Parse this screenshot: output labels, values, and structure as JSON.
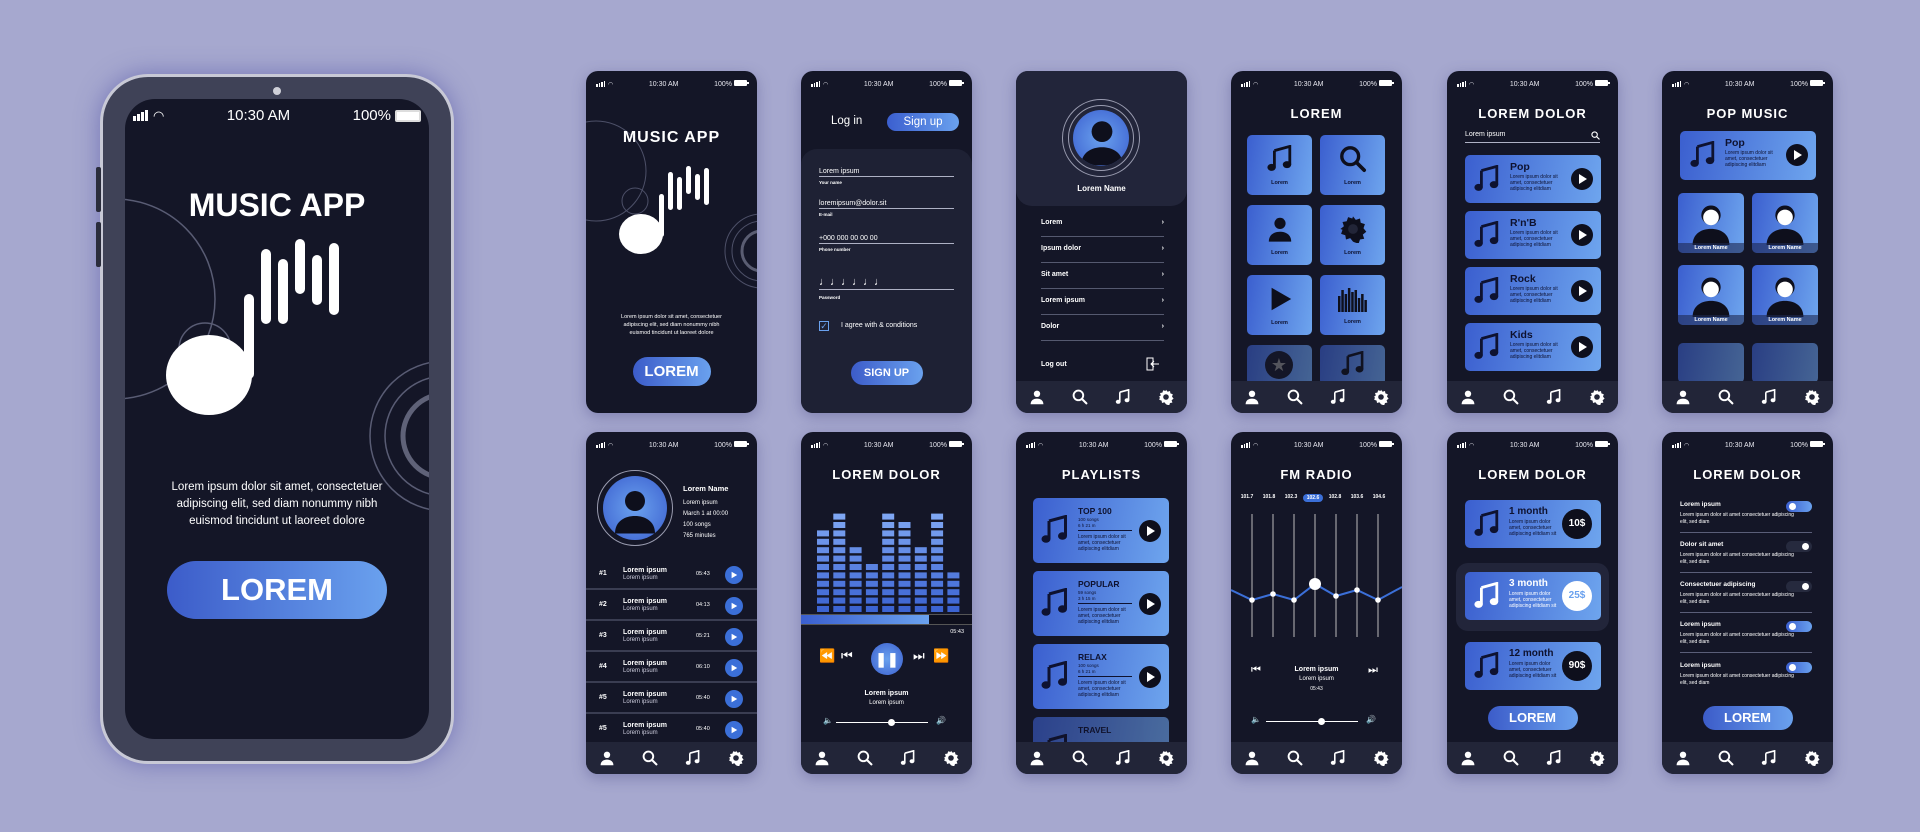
{
  "status_bar": {
    "time": "10:30 AM",
    "battery": "100%"
  },
  "nav": [
    "profile-icon",
    "search-icon",
    "music-note-icon",
    "gear-icon"
  ],
  "colors": {
    "background": "#a6a8cf",
    "screen": "#141627",
    "accent_start": "#3b5fcf",
    "accent_end": "#6ea5ee",
    "nav": "#222538"
  },
  "splash_large": {
    "title": "MUSIC APP",
    "description": "Lorem ipsum dolor sit amet, consectetuer adipiscing elit, sed diam nonummy nibh euismod tincidunt ut laoreet dolore",
    "button": "LOREM"
  },
  "splash": {
    "title": "MUSIC APP",
    "description": "Lorem ipsum dolor sit amet, consectetuer adipiscing elit, sed diam nonummy nibh euismod tincidunt ut laoreet dolore",
    "button": "LOREM"
  },
  "signup": {
    "tab_login": "Log in",
    "tab_signup": "Sign up",
    "fields": [
      {
        "value": "Lorem ipsum",
        "label": "Your name"
      },
      {
        "value": "loremipsum@dolor.sit",
        "label": "E-mail"
      },
      {
        "value": "+000 000 00 00 00",
        "label": "Phone number"
      },
      {
        "value": "♩♩♩♩♩♩",
        "label": "Password"
      }
    ],
    "agree": "I agree with & conditions",
    "button": "SIGN UP"
  },
  "profile": {
    "name": "Lorem Name",
    "menu": [
      "Lorem",
      "Ipsum dolor",
      "Sit amet",
      "Lorem ipsum",
      "Dolor"
    ],
    "logout": "Log out"
  },
  "grid": {
    "title": "LOREM",
    "tiles": [
      {
        "label": "Lorem",
        "icon": "music-note-icon"
      },
      {
        "label": "Lorem",
        "icon": "search-icon"
      },
      {
        "label": "Lorem",
        "icon": "person-icon"
      },
      {
        "label": "Lorem",
        "icon": "gear-icon"
      },
      {
        "label": "Lorem",
        "icon": "play-icon"
      },
      {
        "label": "Lorem",
        "icon": "equalizer-icon"
      }
    ]
  },
  "genres": {
    "title": "LOREM DOLOR",
    "search_value": "Lorem ipsum",
    "items": [
      {
        "name": "Pop",
        "desc": "Lorem ipsum dolor sit amet, consectetuer adipiscing elitdiam"
      },
      {
        "name": "R'n'B",
        "desc": "Lorem ipsum dolor sit amet, consectetuer adipiscing elitdiam"
      },
      {
        "name": "Rock",
        "desc": "Lorem ipsum dolor sit amet, consectetuer adipiscing elitdiam"
      },
      {
        "name": "Kids",
        "desc": "Lorem ipsum dolor sit amet, consectetuer adipiscing elitdiam"
      }
    ]
  },
  "pop_music": {
    "title": "POP MUSIC",
    "feature": {
      "name": "Pop",
      "desc": "Lorem ipsum dolor sit amet, consectetuer adipiscing elitdiam"
    },
    "artists": [
      "Lorem Name",
      "Lorem Name",
      "Lorem Name",
      "Lorem Name"
    ]
  },
  "artist": {
    "name": "Lorem Name",
    "info": [
      "Lorem ipsum",
      "March 1 at 00:00",
      "100 songs",
      "765 minutes"
    ],
    "tracks": [
      {
        "num": "#1",
        "title": "Lorem ipsum",
        "sub": "Lorem ipsum",
        "time": "05:43"
      },
      {
        "num": "#2",
        "title": "Lorem ipsum",
        "sub": "Lorem ipsum",
        "time": "04:13"
      },
      {
        "num": "#3",
        "title": "Lorem ipsum",
        "sub": "Lorem ipsum",
        "time": "05:21"
      },
      {
        "num": "#4",
        "title": "Lorem ipsum",
        "sub": "Lorem ipsum",
        "time": "06:10"
      },
      {
        "num": "#5",
        "title": "Lorem ipsum",
        "sub": "Lorem ipsum",
        "time": "05:40"
      },
      {
        "num": "#5",
        "title": "Lorem ipsum",
        "sub": "Lorem ipsum",
        "time": "05:40"
      }
    ]
  },
  "player": {
    "title": "LOREM DOLOR",
    "eq_levels": [
      10,
      12,
      8,
      6,
      12,
      11,
      8,
      12,
      5
    ],
    "progress": 0.75,
    "time": "05:43",
    "track": "Lorem ipsum",
    "artist": "Lorem ipsum",
    "volume": 0.6
  },
  "playlists": {
    "title": "PLAYLISTS",
    "items": [
      {
        "name": "TOP 100",
        "songs": "100 songs",
        "duration": "6 h 21 m",
        "desc": "Lorem ipsum dolor sit amet, consectetuer adipiscing elitdiam"
      },
      {
        "name": "POPULAR",
        "songs": "59 songs",
        "duration": "3 h 15 m",
        "desc": "Lorem ipsum dolor sit amet, consectetuer adipiscing elitdiam"
      },
      {
        "name": "RELAX",
        "songs": "100 songs",
        "duration": "6 h 21 m",
        "desc": "Lorem ipsum dolor sit amet, consectetuer adipiscing elitdiam"
      },
      {
        "name": "TRAVEL",
        "songs": "",
        "duration": "",
        "desc": ""
      }
    ]
  },
  "radio": {
    "title": "FM RADIO",
    "stations": [
      "101.7",
      "101.8",
      "102.3",
      "102.6",
      "102.8",
      "103.6",
      "104.6"
    ],
    "selected_index": 3,
    "track": "Lorem ipsum",
    "artist": "Lorem ipsum",
    "time": "05:43",
    "volume": 0.6
  },
  "plans": {
    "title": "LOREM DOLOR",
    "items": [
      {
        "name": "1 month",
        "price": "10$",
        "desc": "Lorem ipsum dolor amet, consectetuer adipiscing elitdiam sit"
      },
      {
        "name": "3 month",
        "price": "25$",
        "desc": "Lorem ipsum dolor amet, consectetuer adipiscing elitdiam sit",
        "selected": true
      },
      {
        "name": "12 month",
        "price": "90$",
        "desc": "Lorem ipsum dolor amet, consectetuer adipiscing elitdiam sit"
      }
    ],
    "button": "LOREM"
  },
  "settings": {
    "title": "LOREM DOLOR",
    "items": [
      {
        "name": "Lorem ipsum",
        "desc": "Lorem ipsum dolor sit amet consectetuer adipiscing elit, sed diam",
        "on": true
      },
      {
        "name": "Dolor sit amet",
        "desc": "Lorem ipsum dolor sit amet consectetuer adipiscing elit, sed diam",
        "on": false
      },
      {
        "name": "Consectetuer adipiscing",
        "desc": "Lorem ipsum dolor sit amet consectetuer adipiscing elit, sed diam",
        "on": false
      },
      {
        "name": "Lorem ipsum",
        "desc": "Lorem ipsum dolor sit amet consectetuer adipiscing elit, sed diam",
        "on": true
      },
      {
        "name": "Lorem ipsum",
        "desc": "Lorem ipsum dolor sit amet consectetuer adipiscing elit, sed diam",
        "on": true
      }
    ],
    "button": "LOREM"
  }
}
